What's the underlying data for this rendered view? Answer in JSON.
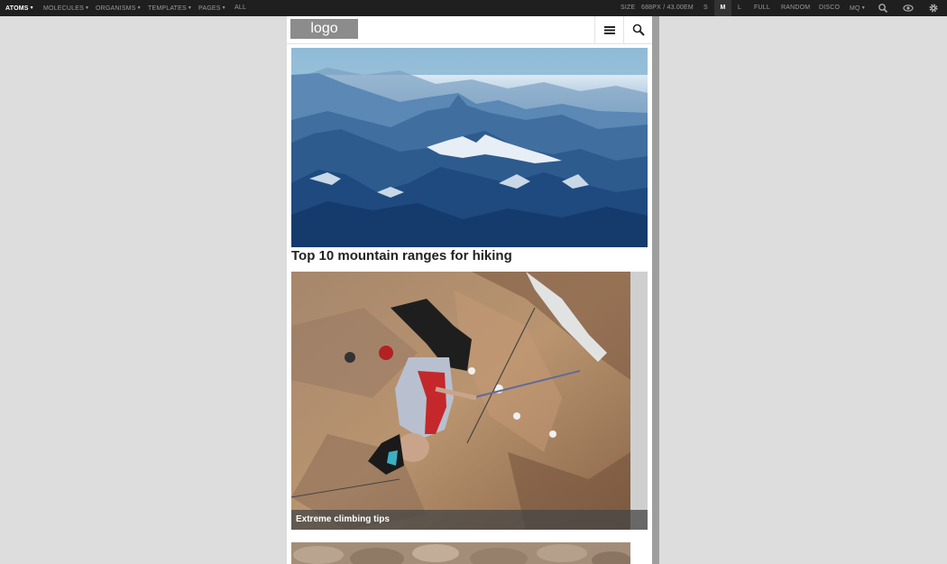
{
  "toolbar": {
    "nav": [
      {
        "label": "ATOMS",
        "has_caret": true,
        "active": true
      },
      {
        "label": "MOLECULES",
        "has_caret": true,
        "active": false
      },
      {
        "label": "ORGANISMS",
        "has_caret": true,
        "active": false
      },
      {
        "label": "TEMPLATES",
        "has_caret": true,
        "active": false
      },
      {
        "label": "PAGES",
        "has_caret": true,
        "active": false
      },
      {
        "label": "ALL",
        "has_caret": false,
        "active": false
      }
    ],
    "size_label": "SIZE",
    "size_px": "688PX",
    "size_sep": "/",
    "size_em": "43.00EM",
    "sizes": [
      "S",
      "M",
      "L",
      "FULL",
      "RANDOM",
      "DISCO"
    ],
    "active_size": "M",
    "mq_label": "MQ",
    "icons": [
      "search-icon",
      "eye-icon",
      "gear-icon"
    ]
  },
  "site": {
    "logo_text": "logo",
    "header_icons": [
      "menu-icon",
      "search-icon"
    ]
  },
  "content": {
    "hero_headline": "Top 10 mountain ranges for hiking",
    "climb_caption": "Extreme climbing tips"
  },
  "colors": {
    "toolbar_bg": "#1f1f1f",
    "page_bg": "#dddddd",
    "logo_bg": "#8c8c8c",
    "caption_bg": "#464646"
  }
}
